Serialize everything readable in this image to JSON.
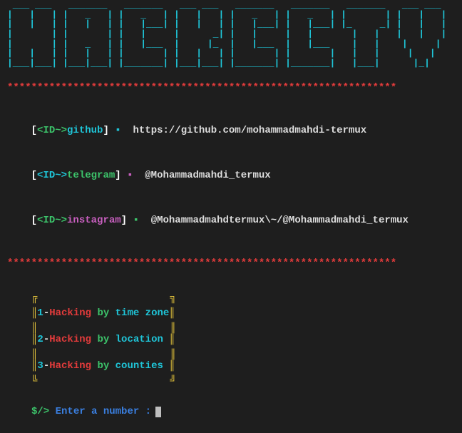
{
  "banner": " ___ ___   _______   _______   ___ ___   _______   _______   _______   ___ ___ \n|   |   | |   _   | |   _   | |   |   | |   _   | |   _   | |       | |   |   |\n|   |   | |   |   | |   |___| |   |   | |   |___| |   |___| |_     _| |   |   |\n|       | |       | |   |     |      _| |   |     |   |       |   |   |   |   |\n|       | |   _   | |   |___  |     |_  |   |___  |   |___    |   |    |     | \n|   |   | |   |   | |       | |   |   | |       | |       |   |   |     |   |  \n|___|___| |___|___| |_______| |___|___| |_______| |_______|   |___|      |_|   ",
  "rule": "*****************************************************************",
  "ids": {
    "open": "[",
    "tag": "<ID~>",
    "close": "]",
    "bullet": "▪",
    "github": {
      "label": "github",
      "value": "https://github.com/mohammadmahdi-termux"
    },
    "telegram": {
      "label": "telegram",
      "value": "@Mohammadmahdi_termux"
    },
    "instagram": {
      "label": "instagram",
      "value": "@Mohammadmahdtermux\\~/@Mohammadmahdi_termux"
    }
  },
  "menu": {
    "bar_top": "╔",
    "bar_mid": "║",
    "bar_bot": "╚",
    "bar_top_r": "╗",
    "bar_bot_r": "╝",
    "items": [
      {
        "num": "1",
        "action": "Hacking",
        "by": "by",
        "target": "time zone"
      },
      {
        "num": "2",
        "action": "Hacking",
        "by": "by",
        "target": "location"
      },
      {
        "num": "3",
        "action": "Hacking",
        "by": "by",
        "target": "counties"
      }
    ]
  },
  "prompt": {
    "sym": "$/>",
    "text": "Enter a number :"
  }
}
